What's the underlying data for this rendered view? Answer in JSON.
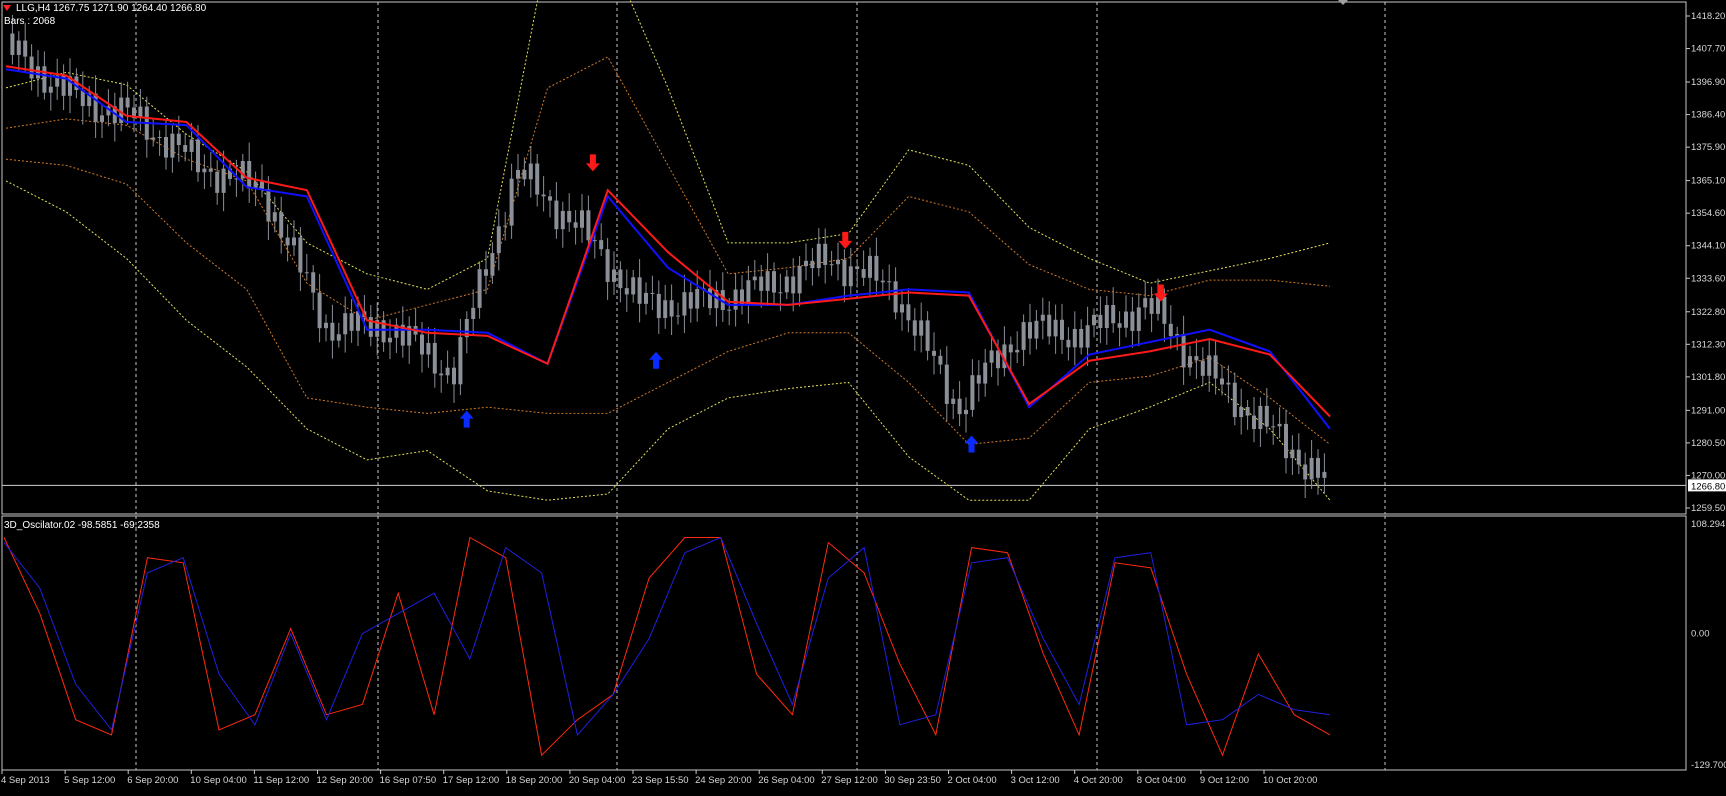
{
  "header": {
    "symbol_line": "LLG,H4  1267.75 1271.90 1264.40 1266.80",
    "bars_line": "Bars : 2068",
    "oscillator_line": "3D_Oscilator.02 -98.5851 -69.2358"
  },
  "colors": {
    "background": "#000000",
    "frame": "#c8c8c8",
    "grid": "#c8c8c8",
    "bull_bar": "#8a8f98",
    "bear_bar": "#8a8f98",
    "ma_blue": "#1010ff",
    "ma_red": "#ff1a1a",
    "band_outer": "#e6e05a",
    "band_inner": "#d07a2a",
    "arrow_up": "#0a2bff",
    "arrow_down": "#ff1a1a",
    "osc_red": "#ff2a10",
    "osc_blue": "#2020e0"
  },
  "price_axis": {
    "labels": [
      "1418.20",
      "1407.70",
      "1396.90",
      "1386.40",
      "1375.90",
      "1365.10",
      "1354.60",
      "1344.10",
      "1333.60",
      "1322.80",
      "1312.30",
      "1301.80",
      "1291.00",
      "1280.50",
      "1270.00",
      "1259.50"
    ],
    "current_price": "1266.80"
  },
  "osc_axis": {
    "labels": [
      "108.2947",
      "0.00",
      "-129.7009"
    ]
  },
  "time_axis": {
    "labels": [
      "4 Sep 2013",
      "5 Sep 12:00",
      "6 Sep 20:00",
      "10 Sep 04:00",
      "11 Sep 12:00",
      "12 Sep 20:00",
      "16 Sep 07:50",
      "17 Sep 12:00",
      "18 Sep 20:00",
      "20 Sep 04:00",
      "23 Sep 15:50",
      "24 Sep 20:00",
      "26 Sep 04:00",
      "27 Sep 12:00",
      "30 Sep 23:50",
      "2 Oct 04:00",
      "3 Oct 12:00",
      "4 Oct 20:00",
      "8 Oct 04:00",
      "9 Oct 12:00",
      "10 Oct 20:00"
    ]
  },
  "chart_data": [
    {
      "type": "candlestick",
      "title": "LLG,H4",
      "ylim": [
        1259.5,
        1418.2
      ],
      "x_range": [
        "4 Sep 2013",
        "10 Oct 20:00"
      ],
      "grid": "vertical dotted",
      "last_bar": {
        "open": 1267.75,
        "high": 1271.9,
        "low": 1264.4,
        "close": 1266.8
      },
      "close_anchors": [
        {
          "x": "4 Sep 2013",
          "close": 1407
        },
        {
          "x": "5 Sep 12:00",
          "close": 1392
        },
        {
          "x": "6 Sep 20:00",
          "close": 1385
        },
        {
          "x": "10 Sep 04:00",
          "close": 1370
        },
        {
          "x": "11 Sep 12:00",
          "close": 1362
        },
        {
          "x": "12 Sep 20:00",
          "close": 1318
        },
        {
          "x": "16 Sep 07:50",
          "close": 1318
        },
        {
          "x": "17 Sep 12:00",
          "close": 1303
        },
        {
          "x": "18 Sep 20:00",
          "close": 1368
        },
        {
          "x": "20 Sep 04:00",
          "close": 1350
        },
        {
          "x": "23 Sep 15:50",
          "close": 1325
        },
        {
          "x": "24 Sep 20:00",
          "close": 1326
        },
        {
          "x": "26 Sep 04:00",
          "close": 1331
        },
        {
          "x": "27 Sep 12:00",
          "close": 1340
        },
        {
          "x": "30 Sep 23:50",
          "close": 1330
        },
        {
          "x": "2 Oct 04:00",
          "close": 1292
        },
        {
          "x": "3 Oct 12:00",
          "close": 1317
        },
        {
          "x": "4 Oct 20:00",
          "close": 1316
        },
        {
          "x": "8 Oct 04:00",
          "close": 1325
        },
        {
          "x": "9 Oct 12:00",
          "close": 1302
        },
        {
          "x": "10 Oct 20:00",
          "close": 1267
        }
      ],
      "moving_averages": [
        {
          "name": "",
          "color": "#1010ff",
          "values": [
            1401,
            1398,
            1384,
            1383,
            1363,
            1360,
            1317,
            1317,
            1316,
            1306,
            1360,
            1337,
            1325,
            1325,
            1328,
            1330,
            1329,
            1292,
            1309,
            1313,
            1317,
            1310,
            1285
          ]
        },
        {
          "name": "",
          "color": "#ff1a1a",
          "values": [
            1402,
            1399,
            1386,
            1384,
            1366,
            1362,
            1320,
            1316,
            1315,
            1306,
            1362,
            1342,
            1326,
            1325,
            1327,
            1329,
            1328,
            1293,
            1307,
            1310,
            1314,
            1309,
            1289
          ]
        }
      ],
      "bands": {
        "upper_outer": [
          1395,
          1400,
          1396,
          1380,
          1368,
          1345,
          1335,
          1330,
          1340,
          1440,
          1440,
          1395,
          1345,
          1345,
          1348,
          1375,
          1370,
          1350,
          1340,
          1332,
          1336,
          1340,
          1345
        ],
        "upper_inner": [
          1382,
          1385,
          1383,
          1372,
          1365,
          1332,
          1320,
          1325,
          1330,
          1395,
          1405,
          1370,
          1335,
          1337,
          1340,
          1360,
          1355,
          1338,
          1330,
          1328,
          1333,
          1333,
          1331
        ],
        "lower_inner": [
          1372,
          1370,
          1364,
          1345,
          1330,
          1295,
          1292,
          1290,
          1292,
          1290,
          1290,
          1300,
          1310,
          1316,
          1316,
          1300,
          1280,
          1282,
          1300,
          1302,
          1308,
          1295,
          1280
        ],
        "lower_outer": [
          1365,
          1355,
          1340,
          1320,
          1305,
          1285,
          1275,
          1278,
          1265,
          1262,
          1264,
          1285,
          1295,
          1298,
          1300,
          1276,
          1262,
          1262,
          1285,
          1292,
          1300,
          1285,
          1262
        ]
      },
      "signals": [
        {
          "type": "buy",
          "x": "17 Sep 12:00",
          "price": 1288
        },
        {
          "type": "sell",
          "x": "20 Sep 04:00",
          "price": 1371
        },
        {
          "type": "buy",
          "x": "23 Sep 15:50",
          "price": 1307
        },
        {
          "type": "sell",
          "x": "27 Sep 12:00",
          "price": 1346
        },
        {
          "type": "buy",
          "x": "2 Oct 04:00",
          "price": 1280
        },
        {
          "type": "sell",
          "x": "8 Oct 04:00",
          "price": 1329
        }
      ]
    },
    {
      "type": "line",
      "title": "3D_Oscilator.02",
      "ylim": [
        -129.7009,
        108.2947
      ],
      "last_values": [
        -98.5851,
        -69.2358
      ],
      "series": [
        {
          "name": "",
          "color": "#ff2a10",
          "values": [
            95,
            20,
            -85,
            -100,
            75,
            70,
            -95,
            -80,
            5,
            -80,
            -70,
            40,
            -80,
            95,
            75,
            -120,
            -85,
            -60,
            55,
            95,
            95,
            -40,
            -80,
            90,
            60,
            -30,
            -100,
            85,
            80,
            -20,
            -100,
            70,
            65,
            -40,
            -120,
            -20,
            -80,
            -100
          ]
        },
        {
          "name": "",
          "color": "#2020e0",
          "values": [
            90,
            45,
            -50,
            -95,
            60,
            75,
            -40,
            -90,
            0,
            -85,
            0,
            20,
            40,
            -25,
            85,
            60,
            -100,
            -60,
            -5,
            80,
            95,
            10,
            -70,
            55,
            85,
            -90,
            -80,
            70,
            75,
            -5,
            -70,
            75,
            80,
            -90,
            -85,
            -60,
            -75,
            -80
          ]
        }
      ]
    }
  ]
}
